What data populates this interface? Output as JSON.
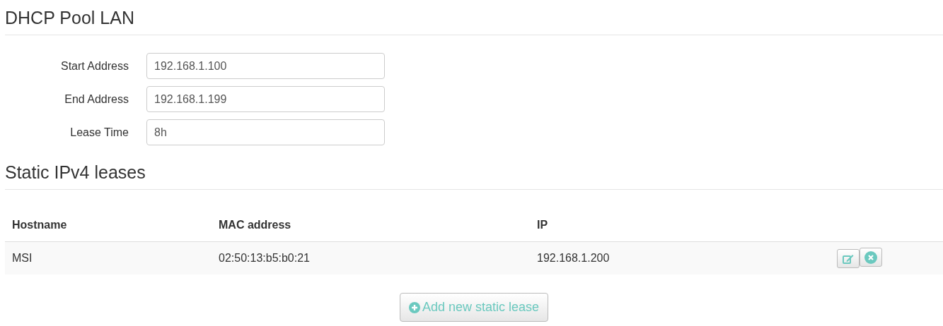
{
  "pool_section": {
    "title": "DHCP Pool LAN",
    "fields": [
      {
        "label": "Start Address",
        "value": "192.168.1.100"
      },
      {
        "label": "End Address",
        "value": "192.168.1.199"
      },
      {
        "label": "Lease Time",
        "value": "8h"
      }
    ]
  },
  "leases_section": {
    "title": "Static IPv4 leases",
    "table": {
      "columns": [
        "Hostname",
        "MAC address",
        "IP"
      ],
      "rows": [
        {
          "cells": [
            "MSI",
            "02:50:13:b5:b0:21",
            "192.168.1.200"
          ]
        }
      ]
    },
    "add_button": "Add new static lease"
  }
}
